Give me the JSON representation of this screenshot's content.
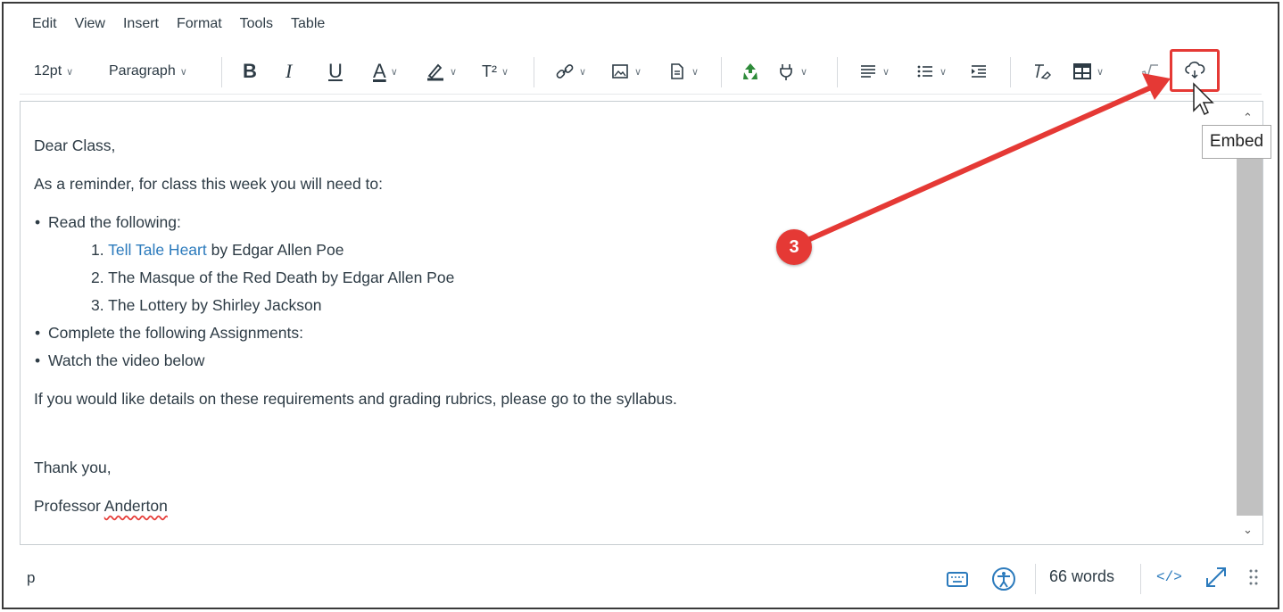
{
  "menu": [
    "Edit",
    "View",
    "Insert",
    "Format",
    "Tools",
    "Table"
  ],
  "toolbar": {
    "font_size": "12pt",
    "block_format": "Paragraph",
    "bold": "B",
    "italic": "I",
    "underline": "U",
    "text_color": "A",
    "superscript": "T²"
  },
  "editor": {
    "greeting": "Dear Class,",
    "intro": "As a reminder, for class this week you will need to:",
    "bullet1": "Read the following:",
    "readings": [
      {
        "num": "1.",
        "link": "Tell Tale Heart",
        "rest": " by Edgar Allen Poe"
      },
      {
        "num": "2.",
        "text": "The Masque of the Red Death by Edgar Allen Poe"
      },
      {
        "num": "3.",
        "text": "The Lottery by Shirley Jackson"
      }
    ],
    "bullet2": "Complete the following Assignments:",
    "bullet3": "Watch the video below",
    "details": "If you would like details on these requirements and grading rubrics, please go to the syllabus.",
    "closing": "Thank you,",
    "signature_first": "Professor",
    "signature_last": "Anderton"
  },
  "tooltip": "Embed",
  "annotation": {
    "badge": "3",
    "color": "#e53935"
  },
  "status": {
    "path": "p",
    "word_count": "66 words",
    "html_toggle": "</>"
  },
  "colors": {
    "link": "#2b7abc",
    "accent": "#e53935",
    "text": "#2d3b45"
  }
}
